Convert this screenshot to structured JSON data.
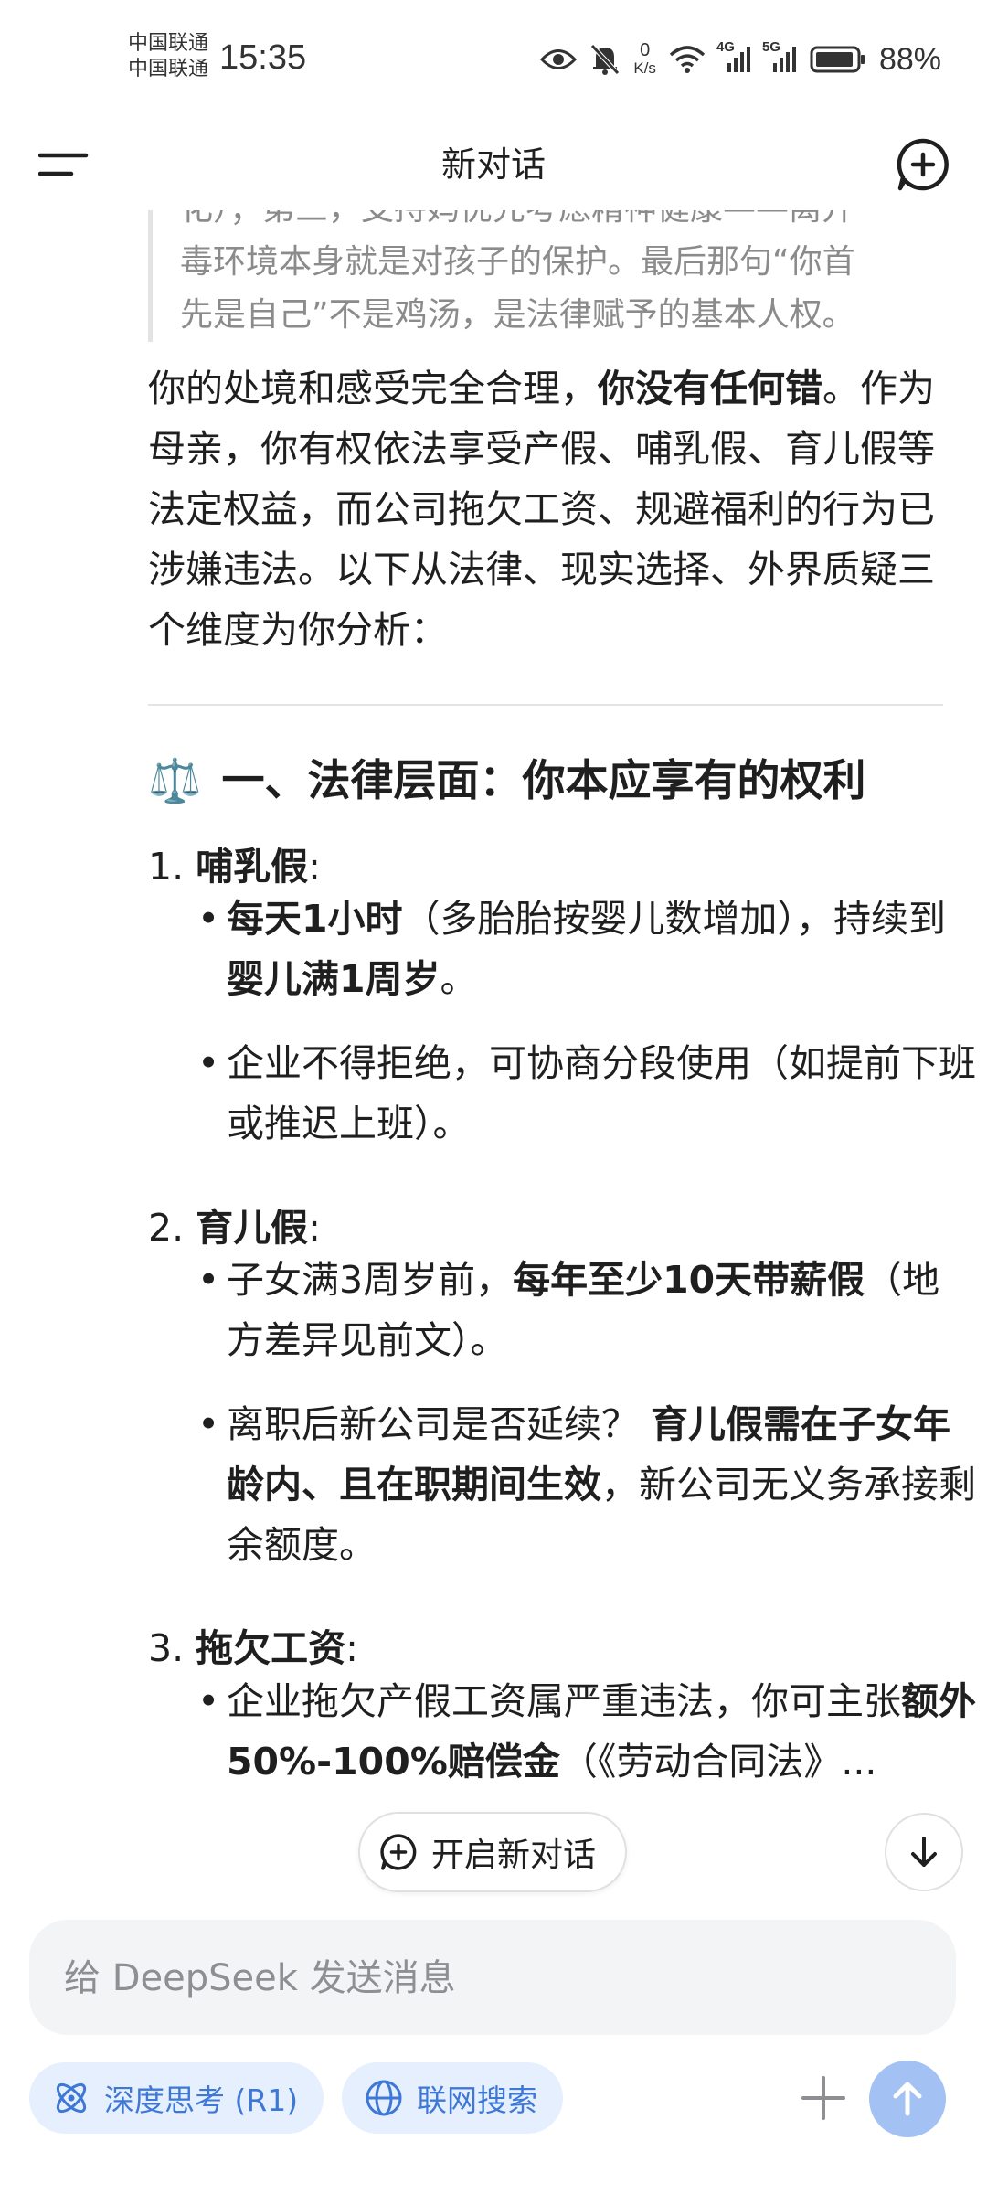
{
  "status_bar": {
    "carrier_1": "中国联通",
    "carrier_2": "中国联通",
    "time": "15:35",
    "net_speed_value": "0",
    "net_speed_unit": "K/s",
    "signal_1_type": "4G",
    "signal_2_type": "5G",
    "battery": "88%"
  },
  "header": {
    "title": "新对话"
  },
  "message": {
    "quote_lines": [
      "化）；第三，支持妈优先考虑精神健康——离开",
      "毒环境本身就是对孩子的保护。最后那句“你首",
      "先是自己”不是鸡汤，是法律赋予的基本人权。"
    ],
    "intro_before": "你的处境和感受完全合理，",
    "intro_bold": "你没有任何错",
    "intro_after": "。作为母亲，你有权依法享受产假、哺乳假、育儿假等法定权益，而公司拖欠工资、规避福利的行为已涉嫌违法。以下从法律、现实选择、外界质疑三个维度为你分析：",
    "section_icon": "⚖️",
    "section_title": "一、法律层面：你本应享有的权利",
    "items": [
      {
        "num": "1.",
        "title": "哺乳假",
        "bullets": [
          {
            "b1": "每天1小时",
            "t1": "（多胎胎按婴儿数增加），持续到",
            "b2": "婴儿满1周岁",
            "t2": "。"
          },
          {
            "t1": "企业不得拒绝，可协商分段使用（如提前下班或推迟上班）。"
          }
        ]
      },
      {
        "num": "2.",
        "title": "育儿假",
        "bullets": [
          {
            "t1": "子女满3周岁前，",
            "b1": "每年至少10天带薪假",
            "t2": "（地方差异见前文）。"
          },
          {
            "t1": "离职后新公司是否延续？ ",
            "b1": "育儿假需在子女年龄内、且在职期间生效",
            "t2": "，新公司无义务承接剩余额度。"
          }
        ]
      },
      {
        "num": "3.",
        "title": "拖欠工资",
        "bullets": [
          {
            "t1": "企业拖欠产假工资属严重违法，你可主张",
            "b1": "额外50%-100%赔偿金",
            "t2": "（《劳动合同法》..."
          }
        ]
      }
    ],
    "colon": ":"
  },
  "floating": {
    "new_chat_label": "开启新对话"
  },
  "composer": {
    "placeholder": "给 DeepSeek 发送消息",
    "deep_think_label": "深度思考 (R1)",
    "web_search_label": "联网搜索"
  },
  "colors": {
    "accent": "#3e78d6",
    "chip_bg": "#e6effd",
    "send_bg": "#a3c1f3"
  },
  "icons": [
    "eye-icon",
    "mute-icon",
    "wifi-icon",
    "signal-icon",
    "battery-icon",
    "menu-icon",
    "new-chat-icon",
    "scale-icon",
    "arrow-down-icon",
    "atom-icon",
    "globe-icon",
    "plus-icon",
    "send-arrow-icon"
  ]
}
